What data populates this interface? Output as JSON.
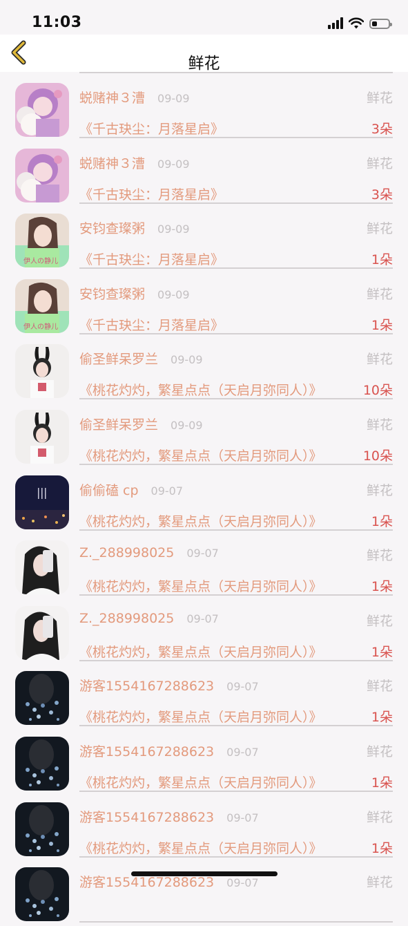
{
  "status_bar": {
    "time": "11:03"
  },
  "nav": {
    "title": "鲜花"
  },
  "colors": {
    "name": "#e39a7d",
    "count": "#d9534f",
    "muted": "#c4c0c2",
    "back_icon": "#e0b93a"
  },
  "rows": [
    {
      "name": "蜕赌神３漕",
      "date": "09-09",
      "type": "鲜花",
      "book": "《千古玦尘：月落星启》",
      "count": "3朵",
      "avatar": "doll"
    },
    {
      "name": "蜕赌神３漕",
      "date": "09-09",
      "type": "鲜花",
      "book": "《千古玦尘：月落星启》",
      "count": "3朵",
      "avatar": "doll"
    },
    {
      "name": "安钧查璨粥",
      "date": "09-09",
      "type": "鲜花",
      "book": "《千古玦尘：月落星启》",
      "count": "1朵",
      "avatar": "girl-green"
    },
    {
      "name": "安钧查璨粥",
      "date": "09-09",
      "type": "鲜花",
      "book": "《千古玦尘：月落星启》",
      "count": "1朵",
      "avatar": "girl-green"
    },
    {
      "name": "偷圣鲜呆罗兰",
      "date": "09-09",
      "type": "鲜花",
      "book": "《桃花灼灼，繁星点点（天启月弥同人）》",
      "count": "10朵",
      "avatar": "bunny-girl"
    },
    {
      "name": "偷圣鲜呆罗兰",
      "date": "09-09",
      "type": "鲜花",
      "book": "《桃花灼灼，繁星点点（天启月弥同人）》",
      "count": "10朵",
      "avatar": "bunny-girl"
    },
    {
      "name": "偷偷磕 cp",
      "date": "09-07",
      "type": "鲜花",
      "book": "《桃花灼灼，繁星点点（天启月弥同人）》",
      "count": "1朵",
      "avatar": "night-sky"
    },
    {
      "name": "Z._288998025",
      "date": "09-07",
      "type": "鲜花",
      "book": "《桃花灼灼，繁星点点（天启月弥同人）》",
      "count": "1朵",
      "avatar": "phone-girl"
    },
    {
      "name": "Z._288998025",
      "date": "09-07",
      "type": "鲜花",
      "book": "《桃花灼灼，繁星点点（天启月弥同人）》",
      "count": "1朵",
      "avatar": "phone-girl"
    },
    {
      "name": "游客1554167288623",
      "date": "09-07",
      "type": "鲜花",
      "book": "《桃花灼灼，繁星点点（天启月弥同人）》",
      "count": "1朵",
      "avatar": "dark-flowers"
    },
    {
      "name": "游客1554167288623",
      "date": "09-07",
      "type": "鲜花",
      "book": "《桃花灼灼，繁星点点（天启月弥同人）》",
      "count": "1朵",
      "avatar": "dark-flowers"
    },
    {
      "name": "游客1554167288623",
      "date": "09-07",
      "type": "鲜花",
      "book": "《桃花灼灼，繁星点点（天启月弥同人）》",
      "count": "1朵",
      "avatar": "dark-flowers"
    },
    {
      "name": "游客1554167288623",
      "date": "09-07",
      "type": "鲜花",
      "book": "",
      "count": "",
      "avatar": "dark-flowers"
    }
  ]
}
